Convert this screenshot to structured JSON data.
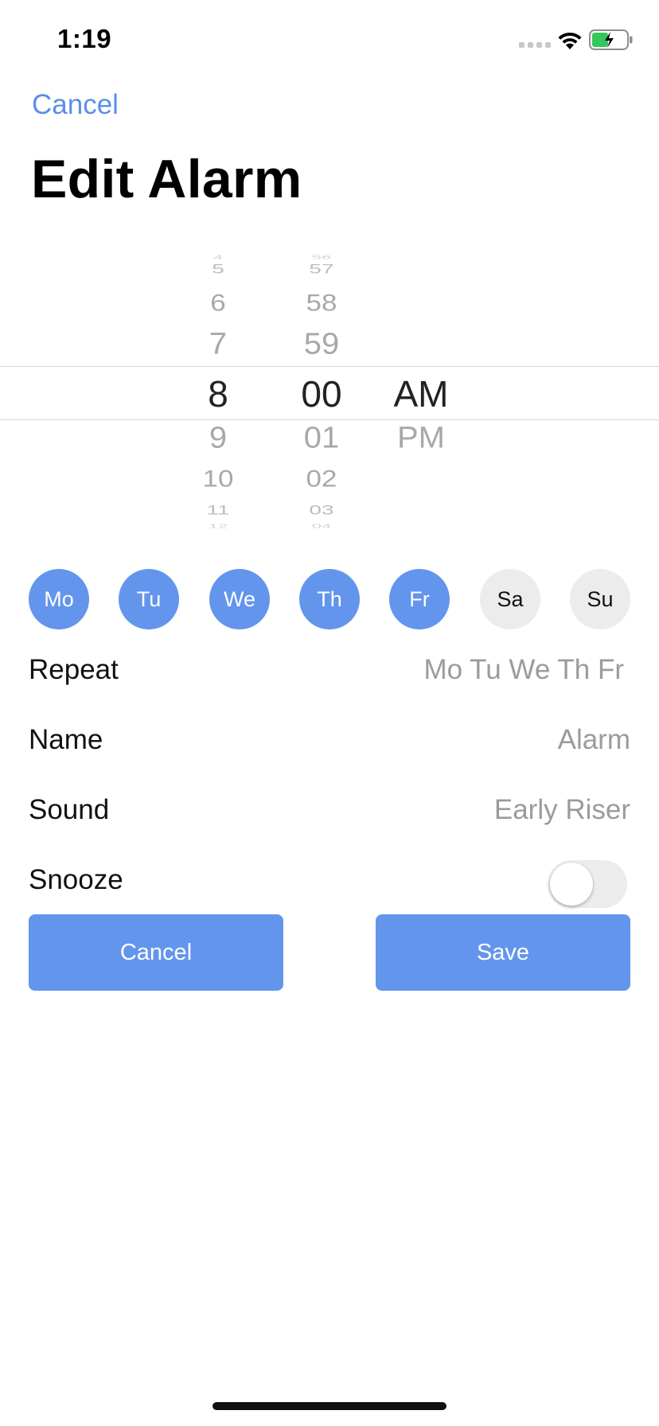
{
  "status_bar": {
    "time": "1:19"
  },
  "nav": {
    "cancel_label": "Cancel",
    "title": "Edit Alarm"
  },
  "picker": {
    "hour": {
      "above": [
        "4",
        "5",
        "6",
        "7"
      ],
      "selected": "8",
      "below": [
        "9",
        "10",
        "11",
        "12"
      ]
    },
    "minute": {
      "above": [
        "56",
        "57",
        "58",
        "59"
      ],
      "selected": "00",
      "below": [
        "01",
        "02",
        "03",
        "04"
      ]
    },
    "period": {
      "selected": "AM",
      "below": [
        "PM"
      ]
    }
  },
  "days": [
    {
      "label": "Mo",
      "selected": true
    },
    {
      "label": "Tu",
      "selected": true
    },
    {
      "label": "We",
      "selected": true
    },
    {
      "label": "Th",
      "selected": true
    },
    {
      "label": "Fr",
      "selected": true
    },
    {
      "label": "Sa",
      "selected": false
    },
    {
      "label": "Su",
      "selected": false
    }
  ],
  "settings": {
    "repeat": {
      "label": "Repeat",
      "value": "Mo Tu We Th Fr"
    },
    "name": {
      "label": "Name",
      "value": "Alarm"
    },
    "sound": {
      "label": "Sound",
      "value": "Early Riser"
    },
    "snooze": {
      "label": "Snooze",
      "on": false
    }
  },
  "buttons": {
    "cancel_label": "Cancel",
    "save_label": "Save"
  },
  "colors": {
    "accent": "#6495ed",
    "link": "#5b8ee8",
    "day_off_bg": "#ececec",
    "secondary_text": "#9b9b9b",
    "battery_green": "#34c759"
  },
  "icons": [
    "signal-icon",
    "wifi-icon",
    "battery-charging-icon"
  ]
}
